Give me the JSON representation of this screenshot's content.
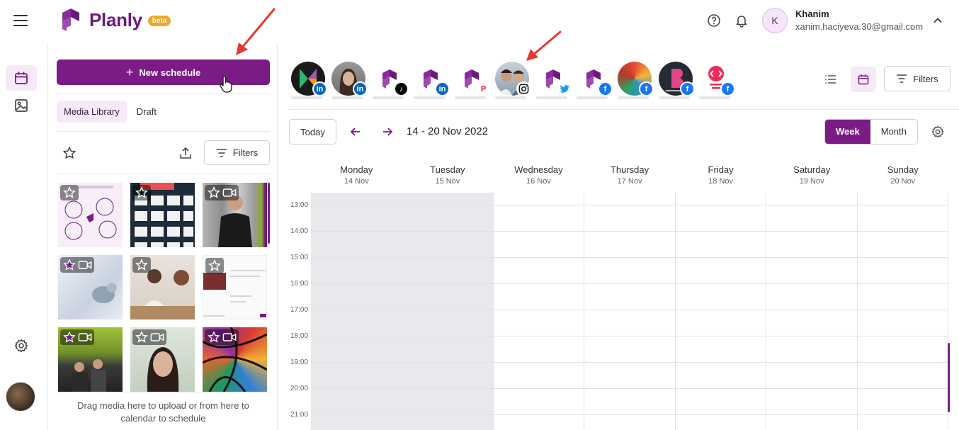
{
  "header": {
    "logo_text": "Planly",
    "beta_badge": "beta",
    "user_initial": "K",
    "user_name": "Khanim",
    "user_email": "xanim.haciyeva.30@gmail.com"
  },
  "media_panel": {
    "new_schedule_label": "New schedule",
    "tabs": [
      {
        "label": "Media Library",
        "active": true
      },
      {
        "label": "Draft",
        "active": false
      }
    ],
    "filters_label": "Filters",
    "drop_hint": "Drag media here to upload or from here to calendar to schedule",
    "thumbnails": [
      {
        "kind": "image",
        "favorite": false,
        "text": "Post Scheduling"
      },
      {
        "kind": "image",
        "favorite": false,
        "text": "Content"
      },
      {
        "kind": "video",
        "favorite": false
      },
      {
        "kind": "video",
        "favorite": true
      },
      {
        "kind": "image",
        "favorite": false
      },
      {
        "kind": "image",
        "favorite": false
      },
      {
        "kind": "video",
        "favorite": true
      },
      {
        "kind": "video",
        "favorite": false
      },
      {
        "kind": "video",
        "favorite": true
      }
    ]
  },
  "accounts": [
    {
      "network": "linkedin",
      "avatar": "colorful-k"
    },
    {
      "network": "linkedin",
      "avatar": "person"
    },
    {
      "network": "tiktok",
      "avatar": "planly"
    },
    {
      "network": "linkedin",
      "avatar": "planly"
    },
    {
      "network": "pinterest",
      "avatar": "planly"
    },
    {
      "network": "instagram",
      "avatar": "person"
    },
    {
      "network": "twitter",
      "avatar": "planly"
    },
    {
      "network": "facebook",
      "avatar": "planly"
    },
    {
      "network": "facebook",
      "avatar": "painting"
    },
    {
      "network": "facebook",
      "avatar": "bookne"
    },
    {
      "network": "facebook",
      "avatar": "code-red"
    }
  ],
  "calendar": {
    "filters_label": "Filters",
    "today_label": "Today",
    "range_label": "14 - 20 Nov 2022",
    "view_week": "Week",
    "view_month": "Month",
    "days": [
      {
        "name": "Monday",
        "date": "14 Nov"
      },
      {
        "name": "Tuesday",
        "date": "15 Nov"
      },
      {
        "name": "Wednesday",
        "date": "16 Nov"
      },
      {
        "name": "Thursday",
        "date": "17 Nov"
      },
      {
        "name": "Friday",
        "date": "18 Nov"
      },
      {
        "name": "Saturday",
        "date": "19 Nov"
      },
      {
        "name": "Sunday",
        "date": "20 Nov"
      }
    ],
    "hours": [
      "13:00",
      "14:00",
      "15:00",
      "16:00",
      "17:00",
      "18:00",
      "19:00",
      "20:00",
      "21:00"
    ]
  },
  "colors": {
    "brand": "#7b1b86",
    "brand_light": "#f6e9f8",
    "linkedin": "#0a66c2",
    "facebook": "#1877f2",
    "twitter": "#1d9bf0",
    "pinterest": "#e60023",
    "tiktok": "#000000",
    "instagram": "#000000",
    "annotation": "#e53935"
  }
}
